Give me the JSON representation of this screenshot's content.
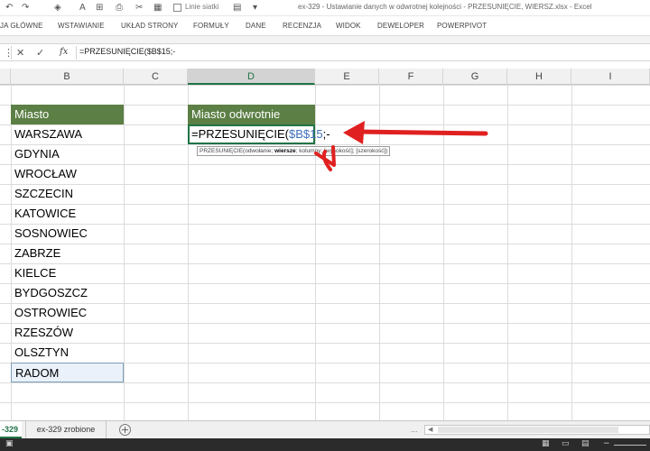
{
  "qat": {
    "gridlines_label": "Linie siatki"
  },
  "title": "ex-329 - Ustawianie danych w odwrotnej kolejności - PRZESUNIĘCIE, WIERSZ.xlsx - Excel",
  "ribbon_tabs": [
    "JA GŁÓWNE",
    "WSTAWIANIE",
    "UKŁAD STRONY",
    "FORMUŁY",
    "DANE",
    "RECENZJA",
    "WIDOK",
    "DEWELOPER",
    "POWERPIVOT"
  ],
  "formula_bar": {
    "cancel_icon": "close-icon",
    "confirm_icon": "check-icon",
    "fx_label": "fx",
    "formula": "=PRZESUNIĘCIE($B$15;-"
  },
  "columns": [
    {
      "label": "B",
      "active": false
    },
    {
      "label": "C",
      "active": false
    },
    {
      "label": "D",
      "active": true
    },
    {
      "label": "E",
      "active": false
    },
    {
      "label": "F",
      "active": false
    },
    {
      "label": "G",
      "active": false
    },
    {
      "label": "H",
      "active": false
    },
    {
      "label": "I",
      "active": false
    }
  ],
  "sheet": {
    "header_b": "Miasto",
    "header_d": "Miasto odwrotnie",
    "cities": [
      "WARSZAWA",
      "GDYNIA",
      "WROCŁAW",
      "SZCZECIN",
      "KATOWICE",
      "SOSNOWIEC",
      "ZABRZE",
      "KIELCE",
      "BYDGOSZCZ",
      "OSTROWIEC",
      "RZESZÓW",
      "OLSZTYN",
      "RADOM"
    ],
    "edit_prefix": "=PRZESUNIĘCIE(",
    "edit_ref": "$B$15",
    "edit_suffix": ";-"
  },
  "tooltip": {
    "fn": "PRZESUNIĘCIE(",
    "arg1": "odwołanie; ",
    "arg2": "wiersze",
    "rest": "; kolumny; [wysokość]; [szerokość])"
  },
  "sheet_tabs": {
    "active": "-329",
    "other": "ex-329 zrobione",
    "dots": "..."
  },
  "colors": {
    "header_fill": "#5b7f44",
    "excel_green": "#217346",
    "arrow_red": "#e02020"
  }
}
